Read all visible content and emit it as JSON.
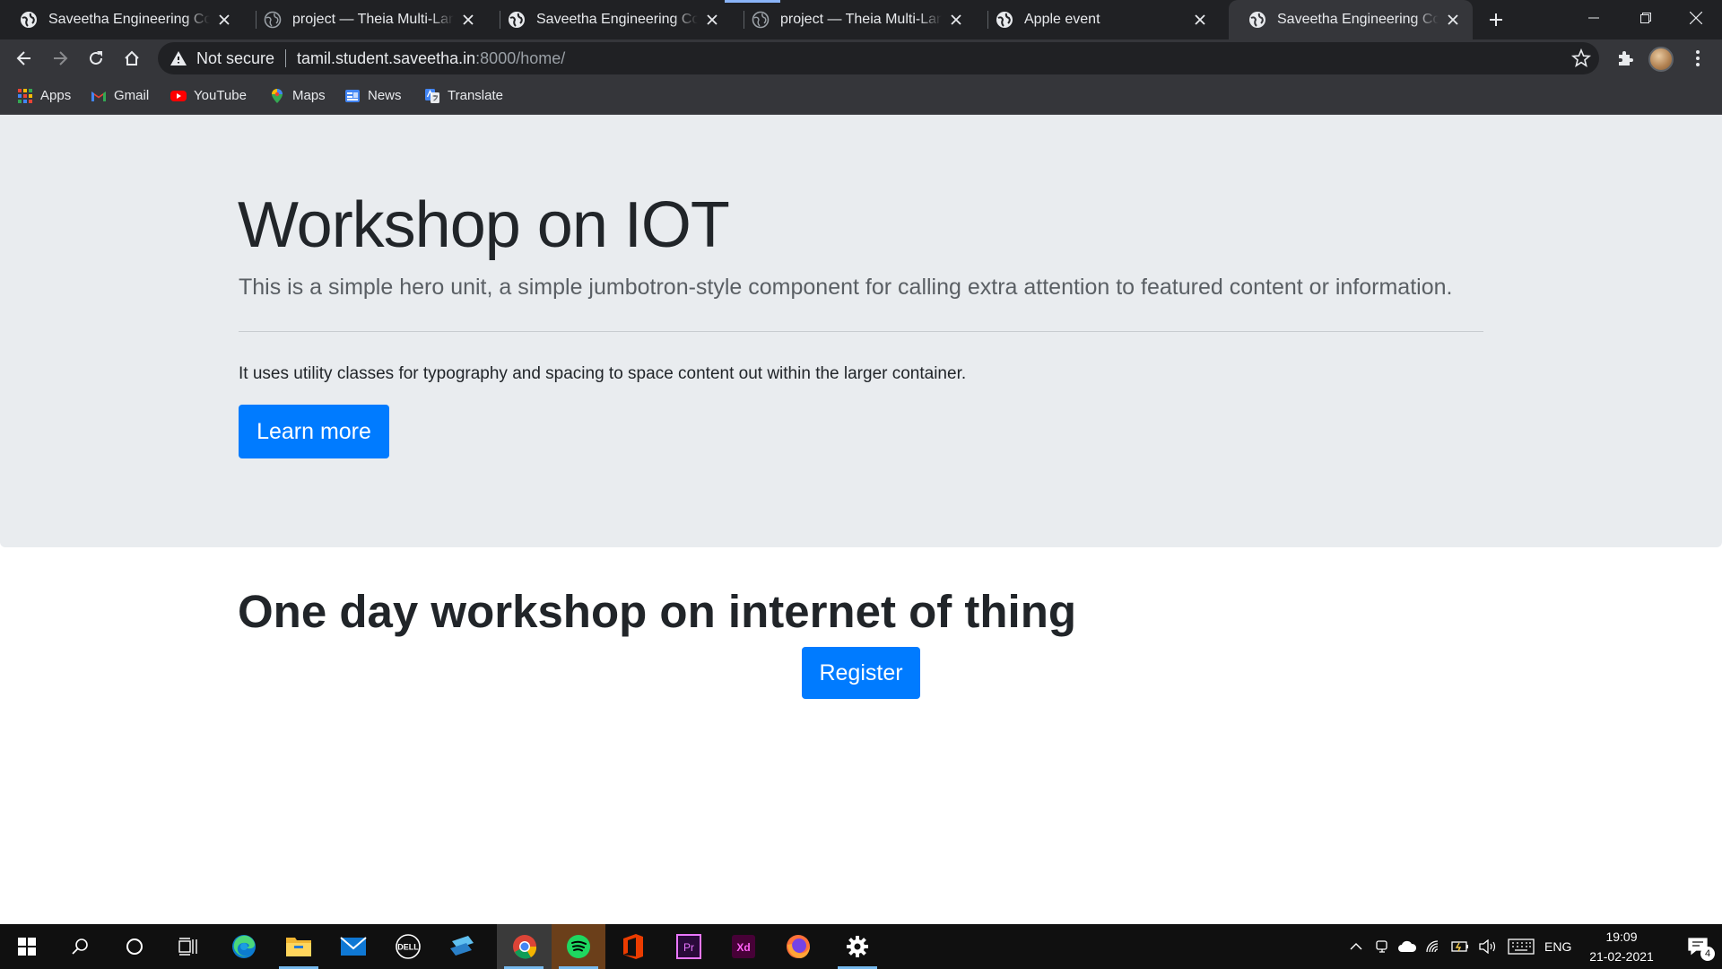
{
  "browser": {
    "tabs": [
      {
        "title": "Saveetha Engineering College",
        "active": false
      },
      {
        "title": "project — Theia Multi-Language",
        "active": false
      },
      {
        "title": "Saveetha Engineering College",
        "active": false
      },
      {
        "title": "project — Theia Multi-Language",
        "active": false
      },
      {
        "title": "Apple event",
        "active": false
      },
      {
        "title": "Saveetha Engineering College",
        "active": true
      }
    ],
    "security_label": "Not secure",
    "url_host": "tamil.student.saveetha.in",
    "url_path": ":8000/home/",
    "bookmarks": [
      {
        "label": "Apps",
        "icon": "apps-grid-icon"
      },
      {
        "label": "Gmail",
        "icon": "gmail-icon"
      },
      {
        "label": "YouTube",
        "icon": "youtube-icon"
      },
      {
        "label": "Maps",
        "icon": "maps-icon"
      },
      {
        "label": "News",
        "icon": "news-icon"
      },
      {
        "label": "Translate",
        "icon": "translate-icon"
      }
    ]
  },
  "jumbotron": {
    "heading": "Workshop on IOT",
    "lead": "This is a simple hero unit, a simple jumbotron-style component for calling extra attention to featured content or information.",
    "body": "It uses utility classes for typography and spacing to space content out within the larger container.",
    "button_label": "Learn more"
  },
  "main": {
    "heading": "One day workshop on internet of thing",
    "register_label": "Register"
  },
  "taskbar": {
    "apps": [
      "start",
      "search",
      "cortana",
      "task-view",
      "edge",
      "file-explorer",
      "mail",
      "dell",
      "folder-app",
      "chrome",
      "spotify",
      "office",
      "premiere-pro",
      "adobe-xd",
      "firefox",
      "settings"
    ],
    "language": "ENG",
    "time": "19:09",
    "date": "21-02-2021",
    "notification_count": "4"
  },
  "colors": {
    "primary": "#007bff",
    "jumbotron_bg": "#e9ecef",
    "chrome_dark": "#202124",
    "chrome_toolbar": "#35363a"
  }
}
